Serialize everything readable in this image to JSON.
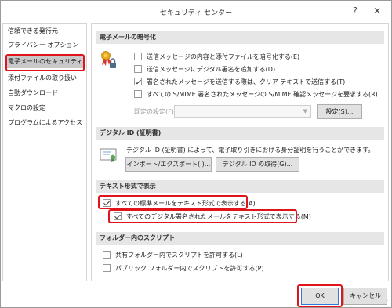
{
  "window": {
    "title": "セキュリティ センター"
  },
  "titlebar": {
    "help_glyph": "?",
    "close_glyph": "✕"
  },
  "sidebar": {
    "items": [
      {
        "label": "信頼できる発行元"
      },
      {
        "label": "プライバシー オプション"
      },
      {
        "label": "電子メールのセキュリティ",
        "selected": true
      },
      {
        "label": "添付ファイルの取り扱い"
      },
      {
        "label": "自動ダウンロード"
      },
      {
        "label": "マクロの設定"
      },
      {
        "label": "プログラムによるアクセス"
      }
    ]
  },
  "encryption": {
    "heading": "電子メールの暗号化",
    "options": [
      {
        "label": "送信メッセージの内容と添付ファイルを暗号化する(E)",
        "checked": false
      },
      {
        "label": "送信メッセージにデジタル署名を追加する(D)",
        "checked": false
      },
      {
        "label": "署名されたメッセージを送信する際は、クリア テキストで送信する(T)",
        "checked": true
      },
      {
        "label": "すべての S/MIME 署名されたメッセージの S/MIME 確認メッセージを要求する(R)",
        "checked": false
      }
    ],
    "default_setting_label": "既定の設定(F):",
    "settings_button": "設定(S)..."
  },
  "digital_id": {
    "heading": "デジタル ID (証明書)",
    "description": "デジタル ID (証明書) によって、電子取り引きにおける身分証明を行うことができます。",
    "import_export_button": "インポート/エクスポート(I)...",
    "get_id_button": "デジタル ID の取得(G)..."
  },
  "plain_text": {
    "heading": "テキスト形式で表示",
    "options": [
      {
        "label": "すべての標準メールをテキスト形式で表示する(A)",
        "checked": true
      },
      {
        "label": "すべてのデジタル署名されたメールをテキスト形式で表示する(M)",
        "checked": true
      }
    ]
  },
  "folder_script": {
    "heading": "フォルダー内のスクリプト",
    "options": [
      {
        "label": "共有フォルダー内でスクリプトを許可する(L)",
        "checked": false
      },
      {
        "label": "パブリック フォルダー内でスクリプトを許可する(P)",
        "checked": false
      }
    ]
  },
  "footer": {
    "ok_label": "OK",
    "cancel_label": "キャンセル"
  },
  "colors": {
    "highlight": "#e0141b",
    "section_header": "#e6e6e6",
    "selected_item": "#c9c9c9"
  }
}
